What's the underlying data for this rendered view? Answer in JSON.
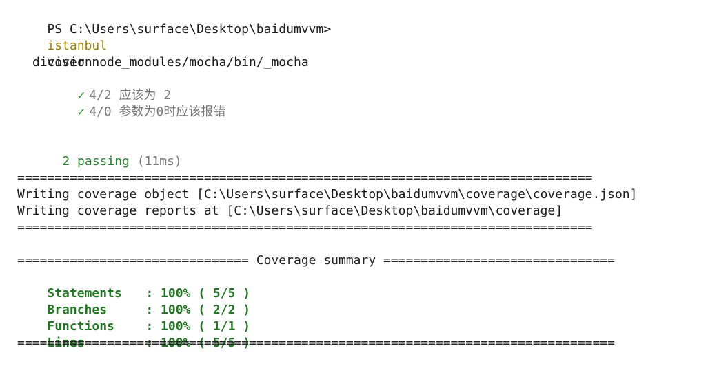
{
  "prompt": {
    "ps_path": "PS C:\\Users\\surface\\Desktop\\baidumvvm>",
    "command": "istanbul",
    "args": "cover node_modules/mocha/bin/_mocha"
  },
  "suite": {
    "name": "division",
    "tests": [
      {
        "check": "✓",
        "id": "4/2",
        "title": "应该为 2"
      },
      {
        "check": "✓",
        "id": "4/0",
        "title": "参数为0时应该报错"
      }
    ]
  },
  "passing": {
    "count_text": "2 passing",
    "duration": "(11ms)"
  },
  "coverage_writing": {
    "separator": "=============================================================================",
    "object_line": "Writing coverage object [C:\\Users\\surface\\Desktop\\baidumvvm\\coverage\\coverage.json]",
    "reports_line": "Writing coverage reports at [C:\\Users\\surface\\Desktop\\baidumvvm\\coverage]"
  },
  "summary": {
    "header": "=============================== Coverage summary ===============================",
    "rows": [
      {
        "label": "Statements",
        "value": ": 100% ( 5/5 )"
      },
      {
        "label": "Branches",
        "value": ": 100% ( 2/2 )"
      },
      {
        "label": "Functions",
        "value": ": 100% ( 1/1 )"
      },
      {
        "label": "Lines",
        "value": ": 100% ( 5/5 )"
      }
    ],
    "footer": "================================================================================"
  }
}
